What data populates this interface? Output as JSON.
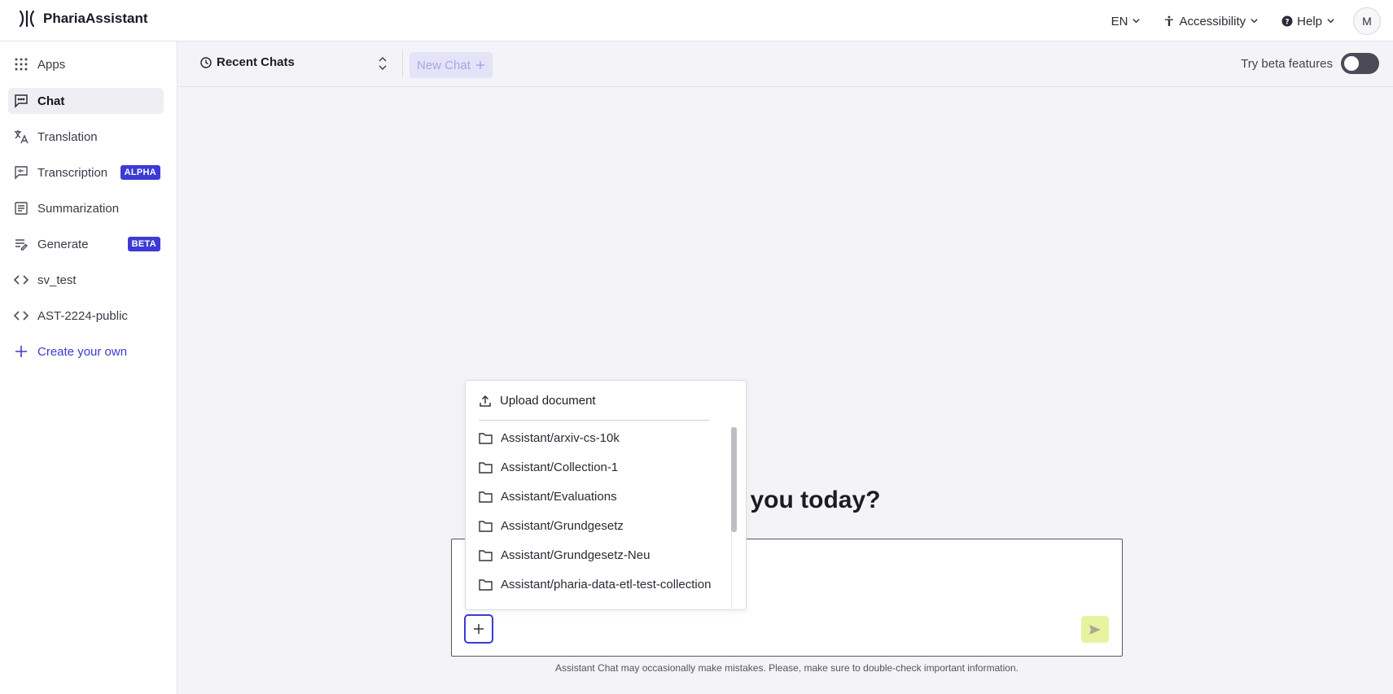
{
  "app": {
    "name": "PhariaAssistant"
  },
  "header": {
    "language": "EN",
    "accessibility": "Accessibility",
    "help": "Help",
    "avatar_initial": "M"
  },
  "sidebar": {
    "items": [
      {
        "label": "Apps",
        "icon": "apps-grid-icon"
      },
      {
        "label": "Chat",
        "icon": "chat-icon",
        "active": true
      },
      {
        "label": "Translation",
        "icon": "translate-icon"
      },
      {
        "label": "Transcription",
        "icon": "transcription-icon",
        "badge": "ALPHA"
      },
      {
        "label": "Summarization",
        "icon": "summarize-icon"
      },
      {
        "label": "Generate",
        "icon": "generate-icon",
        "badge": "BETA"
      },
      {
        "label": "sv_test",
        "icon": "code-icon"
      },
      {
        "label": "AST-2224-public",
        "icon": "code-icon"
      },
      {
        "label": "Create your own",
        "icon": "plus-icon"
      }
    ]
  },
  "subbar": {
    "recent_chats": "Recent Chats",
    "new_chat": "New Chat",
    "beta_label": "Try beta features",
    "beta_enabled": false
  },
  "main": {
    "headline": "help you today?",
    "disclaimer": "Assistant Chat may occasionally make mistakes. Please, make sure to double-check important information."
  },
  "dropdown": {
    "upload": "Upload document",
    "folders": [
      "Assistant/arxiv-cs-10k",
      "Assistant/Collection-1",
      "Assistant/Evaluations",
      "Assistant/Grundgesetz",
      "Assistant/Grundgesetz-Neu",
      "Assistant/pharia-data-etl-test-collection"
    ]
  },
  "colors": {
    "accent": "#3d3ad6",
    "send_button": "#e8f3a0",
    "toggle_off": "#4b4b57"
  }
}
